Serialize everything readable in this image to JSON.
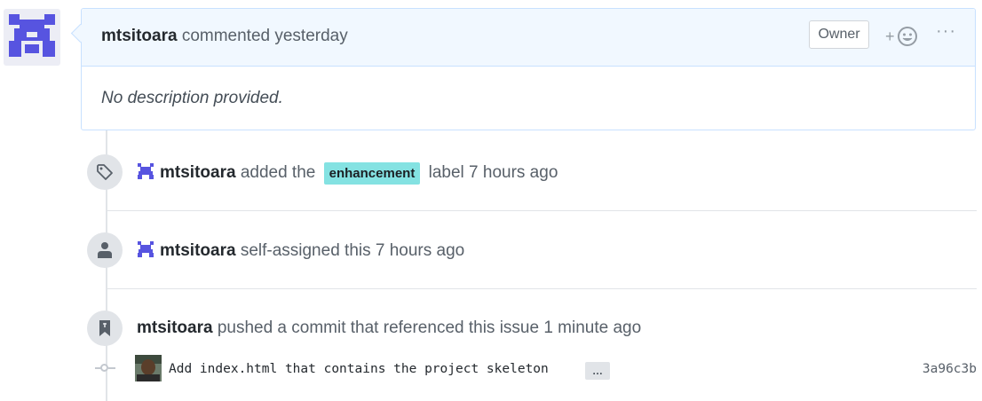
{
  "colors": {
    "avatar_accent": "#5754e0",
    "label_bg": "#84e2e2",
    "header_bg": "#f1f8ff",
    "border": "#c8e1ff"
  },
  "comment": {
    "author": "mtsitoara",
    "action": "commented yesterday",
    "owner_badge": "Owner",
    "reaction_plus": "+",
    "reaction_icon": "smiley-icon",
    "more_label": "···",
    "body": "No description provided."
  },
  "events": [
    {
      "icon": "tag-icon",
      "actor": "mtsitoara",
      "text_before": "added the",
      "label": "enhancement",
      "text_after": "label 7 hours ago"
    },
    {
      "icon": "person-icon",
      "actor": "mtsitoara",
      "text": "self-assigned this 7 hours ago"
    },
    {
      "icon": "bookmark-icon",
      "actor": "mtsitoara",
      "text": "pushed a commit that referenced this issue 1 minute ago"
    }
  ],
  "commit": {
    "message": "Add index.html that contains the project skeleton",
    "ellipsis": "…",
    "sha": "3a96c3b"
  }
}
